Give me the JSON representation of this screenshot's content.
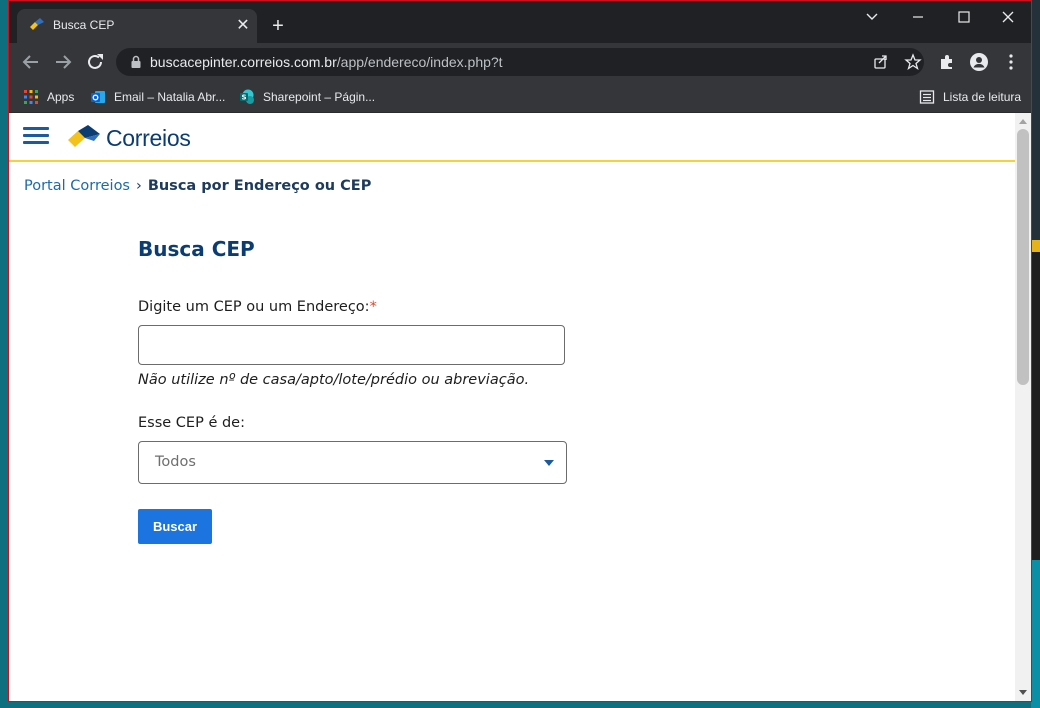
{
  "browser": {
    "tab_title": "Busca CEP",
    "tab_close": "✕",
    "new_tab": "+",
    "url_host": "buscacepinter.correios.com.br",
    "url_path": "/app/endereco/index.php?t"
  },
  "bookmarks": {
    "items": [
      {
        "label": "Apps",
        "icon": "apps-grid-icon"
      },
      {
        "label": "Email – Natalia Abr...",
        "icon": "outlook-icon"
      },
      {
        "label": "Sharepoint – Págin...",
        "icon": "sharepoint-icon"
      }
    ],
    "reading_list": "Lista de leitura"
  },
  "site": {
    "logo_text": "Correios",
    "breadcrumb": {
      "home": "Portal Correios",
      "separator": "›",
      "current": "Busca por Endereço ou CEP"
    }
  },
  "form": {
    "title": "Busca CEP",
    "cep_label": "Digite um CEP ou um Endereço:",
    "required_mark": "*",
    "cep_value": "",
    "hint": "Não utilize nº de casa/apto/lote/prédio ou abreviação.",
    "type_label": "Esse CEP é de:",
    "type_selected": "Todos",
    "submit_label": "Buscar"
  },
  "colors": {
    "brand_blue": "#0b3c72",
    "button_blue": "#1b74e0",
    "header_yellow": "#f5d13c",
    "window_border": "#d20e1e"
  }
}
